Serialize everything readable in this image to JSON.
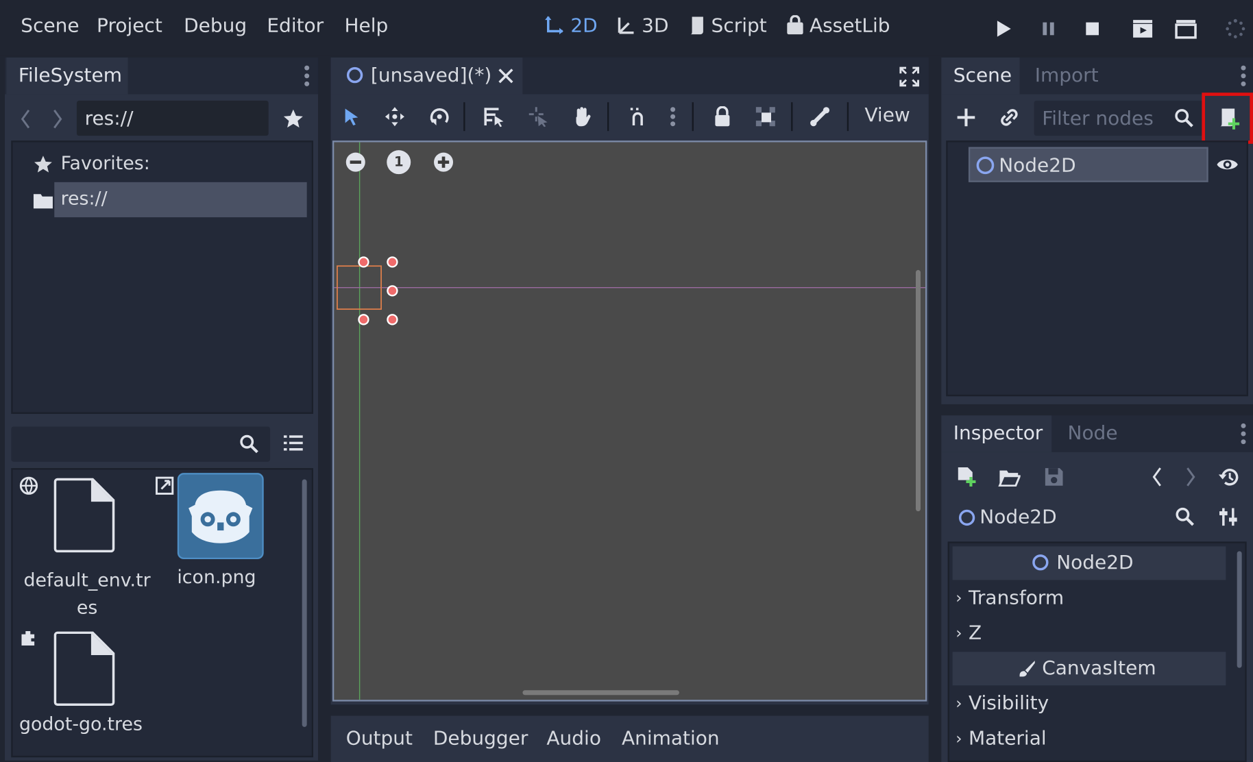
{
  "menu": {
    "items": [
      "Scene",
      "Project",
      "Debug",
      "Editor",
      "Help"
    ]
  },
  "workspaces": {
    "items": [
      {
        "label": "2D",
        "icon": "2d-icon",
        "active": true
      },
      {
        "label": "3D",
        "icon": "3d-icon",
        "active": false
      },
      {
        "label": "Script",
        "icon": "script-icon",
        "active": false
      },
      {
        "label": "AssetLib",
        "icon": "assetlib-icon",
        "active": false
      }
    ]
  },
  "filesystem": {
    "tab_label": "FileSystem",
    "path_value": "res://",
    "favorites_label": "Favorites:",
    "root_label": "res://",
    "search_placeholder": "",
    "files": [
      {
        "name": "default_env.tr\nes",
        "type": "file"
      },
      {
        "name": "icon.png",
        "type": "image"
      },
      {
        "name": "godot-go.tres",
        "type": "file"
      }
    ]
  },
  "editor": {
    "tab_label": "[unsaved](*)",
    "view_label": "View",
    "zoom_reset": "1"
  },
  "bottom_tabs": [
    "Output",
    "Debugger",
    "Audio",
    "Animation"
  ],
  "scene": {
    "tabs": [
      "Scene",
      "Import"
    ],
    "filter_placeholder": "Filter nodes",
    "root_node": "Node2D"
  },
  "inspector": {
    "tabs": [
      "Inspector",
      "Node"
    ],
    "object_name": "Node2D",
    "sections": [
      {
        "label": "Node2D",
        "kind": "header"
      },
      {
        "label": "Transform",
        "kind": "group"
      },
      {
        "label": "Z",
        "kind": "group"
      },
      {
        "label": "CanvasItem",
        "kind": "header"
      },
      {
        "label": "Visibility",
        "kind": "group"
      },
      {
        "label": "Material",
        "kind": "group"
      }
    ]
  },
  "colors": {
    "accent": "#6fa7f2",
    "highlight_box": "#e01010",
    "handle": "#ef6b6b"
  }
}
